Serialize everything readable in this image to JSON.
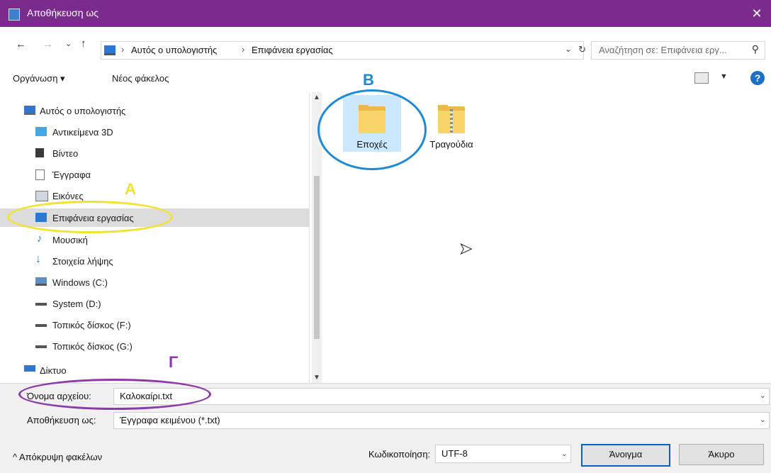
{
  "window": {
    "title": "Αποθήκευση ως",
    "close_glyph": "✕",
    "accent": "#7b2a8e"
  },
  "address": {
    "breadcrumb": [
      "Αυτός ο υπολογιστής",
      "Επιφάνεια εργασίας"
    ],
    "separator": "›",
    "search_placeholder": "Αναζήτηση σε: Επιφάνεια εργ..."
  },
  "toolbar": {
    "organize": "Οργάνωση ▾",
    "new_folder": "Νέος φάκελος",
    "help": "?"
  },
  "sidebar": {
    "items": [
      {
        "label": "Αυτός ο υπολογιστής",
        "icon": "computer-icon"
      },
      {
        "label": "Αντικείμενα 3D",
        "icon": "3d-objects-icon"
      },
      {
        "label": "Βίντεο",
        "icon": "video-icon"
      },
      {
        "label": "Έγγραφα",
        "icon": "documents-icon"
      },
      {
        "label": "Εικόνες",
        "icon": "pictures-icon"
      },
      {
        "label": "Επιφάνεια εργασίας",
        "icon": "desktop-icon",
        "selected": true
      },
      {
        "label": "Μουσική",
        "icon": "music-icon"
      },
      {
        "label": "Στοιχεία λήψης",
        "icon": "downloads-icon"
      },
      {
        "label": "Windows (C:)",
        "icon": "drive-icon"
      },
      {
        "label": "System (D:)",
        "icon": "drive-icon"
      },
      {
        "label": "Τοπικός δίσκος (F:)",
        "icon": "drive-icon"
      },
      {
        "label": "Τοπικός δίσκος (G:)",
        "icon": "drive-icon"
      },
      {
        "label": "Δίκτυο",
        "icon": "network-icon"
      }
    ]
  },
  "files": [
    {
      "name": "Εποχές",
      "type": "folder",
      "selected": true
    },
    {
      "name": "Τραγούδια",
      "type": "zip-folder",
      "selected": false
    }
  ],
  "form": {
    "filename_label": "Όνομα αρχείου:",
    "filename_value": "Καλοκαίρι.txt",
    "savetype_label": "Αποθήκευση ως:",
    "savetype_value": "Έγγραφα κειμένου (*.txt)",
    "encoding_label": "Κωδικοποίηση:",
    "encoding_value": "UTF-8",
    "open_button": "Άνοιγμα",
    "cancel_button": "Άκυρο",
    "hide_folders": "Απόκρυψη φακέλων"
  },
  "annotations": {
    "A": {
      "text": "Α",
      "color": "#f3e22c"
    },
    "B": {
      "text": "Β",
      "color": "#1c8ad8"
    },
    "G": {
      "text": "Γ",
      "color": "#8c3aa8"
    }
  }
}
